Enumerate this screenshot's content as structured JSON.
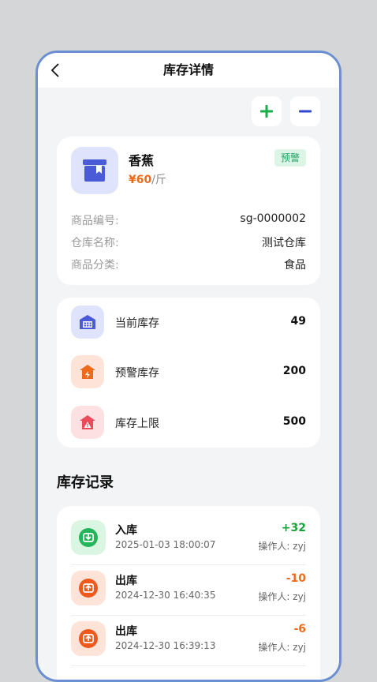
{
  "header": {
    "title": "库存详情"
  },
  "product": {
    "name": "香蕉",
    "price_symbol": "¥",
    "price": "60",
    "unit": "/斤",
    "badge": "预警",
    "fields": [
      {
        "label": "商品编号:",
        "value": "sg-0000002"
      },
      {
        "label": "仓库名称:",
        "value": "测试仓库"
      },
      {
        "label": "商品分类:",
        "value": "食品"
      }
    ]
  },
  "stock": [
    {
      "label": "当前库存",
      "value": "49",
      "icon": "warehouse-icon",
      "color": "#4b5bd8",
      "bg": "#dfe3fb"
    },
    {
      "label": "预警库存",
      "value": "200",
      "icon": "warning-house-icon",
      "color": "#ef6b1c",
      "bg": "#fde3d8"
    },
    {
      "label": "库存上限",
      "value": "500",
      "icon": "limit-house-icon",
      "color": "#ea4a5a",
      "bg": "#fde0e2"
    }
  ],
  "records_title": "库存记录",
  "records": [
    {
      "type": "入库",
      "time": "2025-01-03 18:00:07",
      "qty": "+32",
      "operator": "操作人: zyj",
      "qty_color": "#18a33a",
      "icon_bg": "#dbf5e3",
      "icon_color": "#22b55a"
    },
    {
      "type": "出库",
      "time": "2024-12-30 16:40:35",
      "qty": "-10",
      "operator": "操作人: zyj",
      "qty_color": "#ef6b1c",
      "icon_bg": "#fde3d8",
      "icon_color": "#ef5a1c"
    },
    {
      "type": "出库",
      "time": "2024-12-30 16:39:13",
      "qty": "-6",
      "operator": "操作人: zyj",
      "qty_color": "#ef6b1c",
      "icon_bg": "#fde3d8",
      "icon_color": "#ef5a1c"
    }
  ],
  "colors": {
    "add": "#1aad4b",
    "minus": "#3346cc",
    "frame": "#6b8fd1"
  }
}
